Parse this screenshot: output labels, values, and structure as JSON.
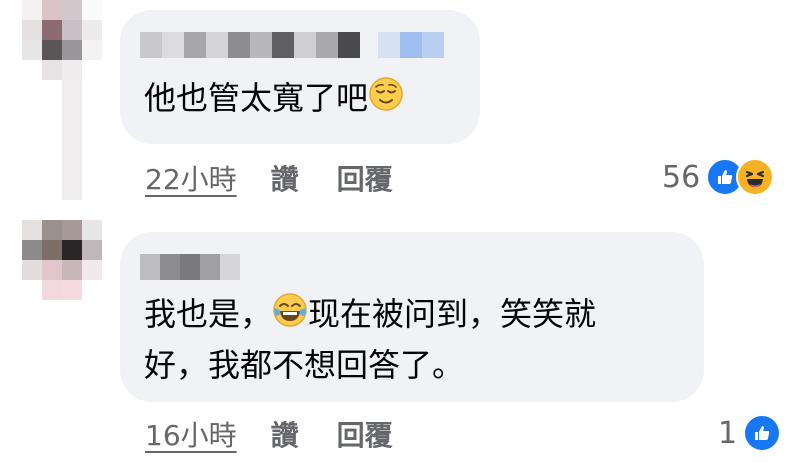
{
  "comments": [
    {
      "text": "他也管太寬了吧",
      "emoji": "relieved-face",
      "time": "22小時",
      "like_label": "讚",
      "reply_label": "回覆",
      "reaction_count": "56",
      "reactions": [
        "like",
        "laugh"
      ]
    },
    {
      "text_line1_a": "我也是，",
      "emoji": "face-with-tears-of-joy",
      "text_line1_b": "现在被问到，笑笑就",
      "text_line2": "好，我都不想回答了。",
      "time": "16小時",
      "like_label": "讚",
      "reply_label": "回覆",
      "reaction_count": "1",
      "reactions": [
        "like"
      ]
    }
  ],
  "colors": {
    "bubble": "#f0f2f5",
    "meta_text": "#65676b",
    "like_blue": "#1877f2",
    "laugh_yellow": "#f7b125"
  }
}
